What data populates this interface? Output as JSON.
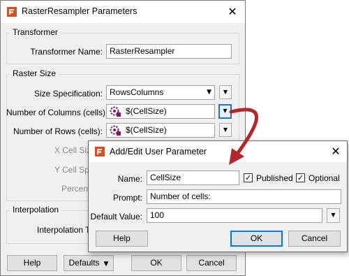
{
  "main_window": {
    "title": "RasterResampler Parameters",
    "icons": {
      "app": "fme-gear-icon",
      "close": "close-icon"
    },
    "transformer_group": {
      "legend": "Transformer",
      "name_label": "Transformer Name:",
      "name_value": "RasterResampler"
    },
    "raster_size_group": {
      "legend": "Raster Size",
      "size_spec_label": "Size Specification:",
      "size_spec_value": "RowsColumns",
      "columns_label": "Number of Columns (cells):",
      "columns_value": "$(CellSize)",
      "rows_label": "Number of Rows (cells):",
      "rows_value": "$(CellSize)",
      "x_cell_label": "X Cell Size",
      "y_cell_label": "Y Cell Spa",
      "percent_label": "Percent"
    },
    "interpolation_group": {
      "legend": "Interpolation",
      "type_label": "Interpolation T"
    },
    "buttons": {
      "help": "Help",
      "defaults": "Defaults",
      "ok": "OK",
      "cancel": "Cancel"
    }
  },
  "dialog": {
    "title": "Add/Edit User Parameter",
    "name_label": "Name:",
    "name_value": "CellSize",
    "published_label": "Published",
    "published_checked": true,
    "optional_label": "Optional",
    "optional_checked": true,
    "prompt_label": "Prompt:",
    "prompt_value": "Number of cells:",
    "default_label": "Default Value:",
    "default_value": "100",
    "buttons": {
      "help": "Help",
      "ok": "OK",
      "cancel": "Cancel"
    }
  },
  "colors": {
    "annotation_arrow": "#b3262b",
    "focus_border": "#2b6ec8"
  }
}
